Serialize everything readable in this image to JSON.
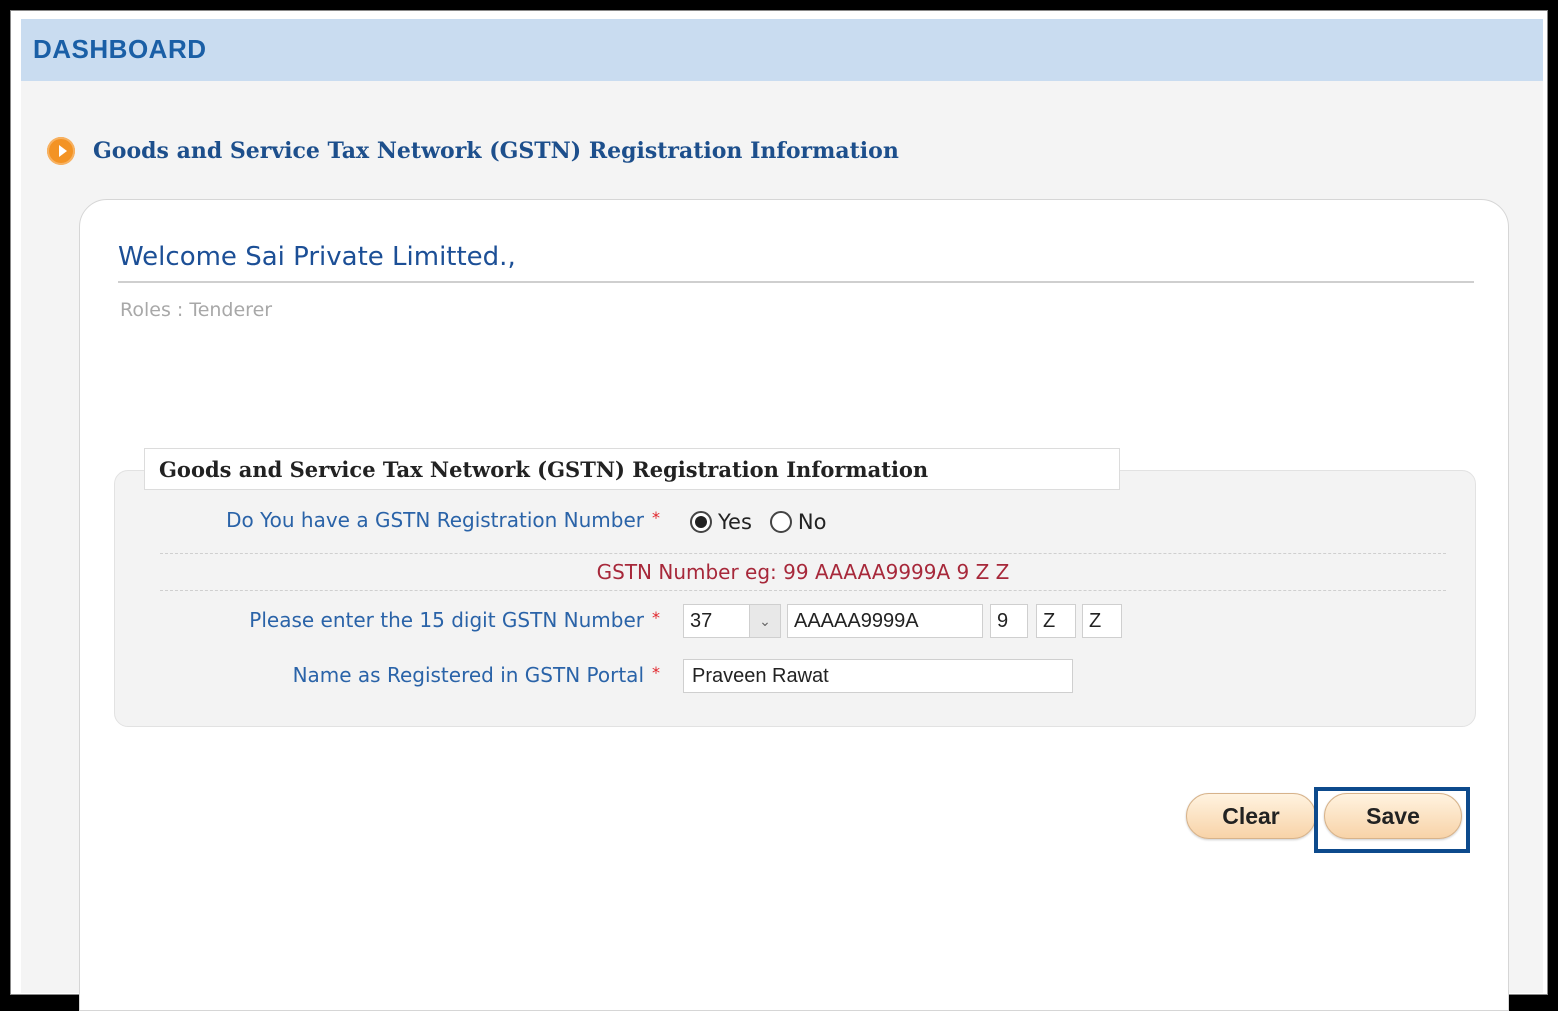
{
  "dashboard": {
    "title": "DASHBOARD"
  },
  "page": {
    "heading": "Goods and Service Tax Network (GSTN) Registration Information"
  },
  "welcome": {
    "text": "Welcome Sai Private Limitted.,",
    "roles": "Roles : Tenderer"
  },
  "form": {
    "legend": "Goods and Service Tax Network (GSTN) Registration Information",
    "has_gstn": {
      "label": "Do You have a GSTN Registration Number",
      "required_mark": "*",
      "options": [
        "Yes",
        "No"
      ],
      "selected": "Yes"
    },
    "hint": "GSTN Number eg: 99 AAAAA9999A 9 Z Z",
    "gstn_number": {
      "label": "Please enter the 15 digit GSTN Number",
      "required_mark": "*",
      "state_code": "37",
      "pan": "AAAAA9999A",
      "entity": "9",
      "default_char": "Z",
      "check_digit": "Z"
    },
    "registered_name": {
      "label": "Name as Registered in GSTN Portal",
      "required_mark": "*",
      "value": "Praveen Rawat"
    }
  },
  "buttons": {
    "clear": "Clear",
    "save": "Save"
  },
  "colors": {
    "header_bg": "#c9dcf0",
    "title_blue": "#1a5fa6",
    "accent_orange": "#f39324",
    "required_red": "#e0242a",
    "highlight_border": "#0d4a8c"
  }
}
